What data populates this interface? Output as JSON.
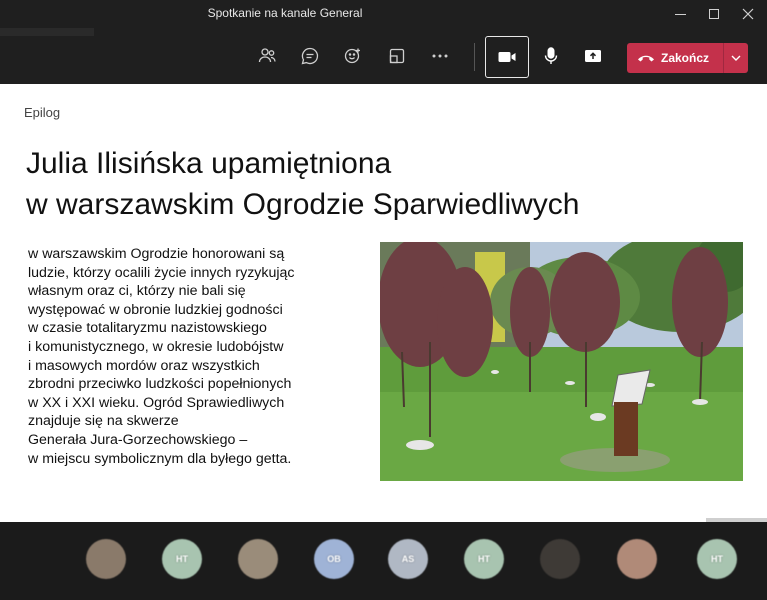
{
  "window": {
    "title": "Spotkanie na kanale General"
  },
  "toolbar": {
    "people_icon": "people-icon",
    "chat_icon": "chat-icon",
    "react_icon": "reactions-icon",
    "rooms_icon": "breakout-rooms-icon",
    "more_icon": "more-icon",
    "camera_icon": "video-camera-icon",
    "mic_icon": "microphone-icon",
    "share_icon": "share-screen-icon",
    "end_call_label": "Zakończ",
    "end_call_color": "#c4314b"
  },
  "slide": {
    "section": "Epilog",
    "title_line1": "Julia Ilisińska  upamiętniona",
    "title_line2": "w warszawskim Ogrodzie Sparwiedliwych",
    "body_lines": [
      "w warszawskim Ogrodzie honorowani są",
      "ludzie, którzy ocalili życie innych ryzykując",
      "własnym oraz ci, którzy nie bali się",
      "występować w obronie ludzkiej godności",
      "w czasie totalitaryzmu nazistowskiego",
      "i komunistycznego, w okresie ludobójstw",
      "i masowych mordów oraz wszystkich",
      "zbrodni przeciwko ludzkości popełnionych",
      "w XX i XXI wieku. Ogród Sprawiedliwych",
      "znajduje się na skwerze",
      "Generała Jura-Gorzechowskiego –",
      "w miejscu symbolicznym dla byłego getta."
    ]
  },
  "participants": [
    {
      "initials": "",
      "color": "#8a7a6a"
    },
    {
      "initials": "HT",
      "color": "#a8c4b0"
    },
    {
      "initials": "",
      "color": "#9a8c7a"
    },
    {
      "initials": "OB",
      "color": "#9fb3d6"
    },
    {
      "initials": "AS",
      "color": "#b0b8c4"
    },
    {
      "initials": "HT",
      "color": "#a8c4b0"
    },
    {
      "initials": "",
      "color": "#3e3a36"
    },
    {
      "initials": "",
      "color": "#b08a78"
    },
    {
      "initials": "HT",
      "color": "#a8c4b0"
    }
  ]
}
